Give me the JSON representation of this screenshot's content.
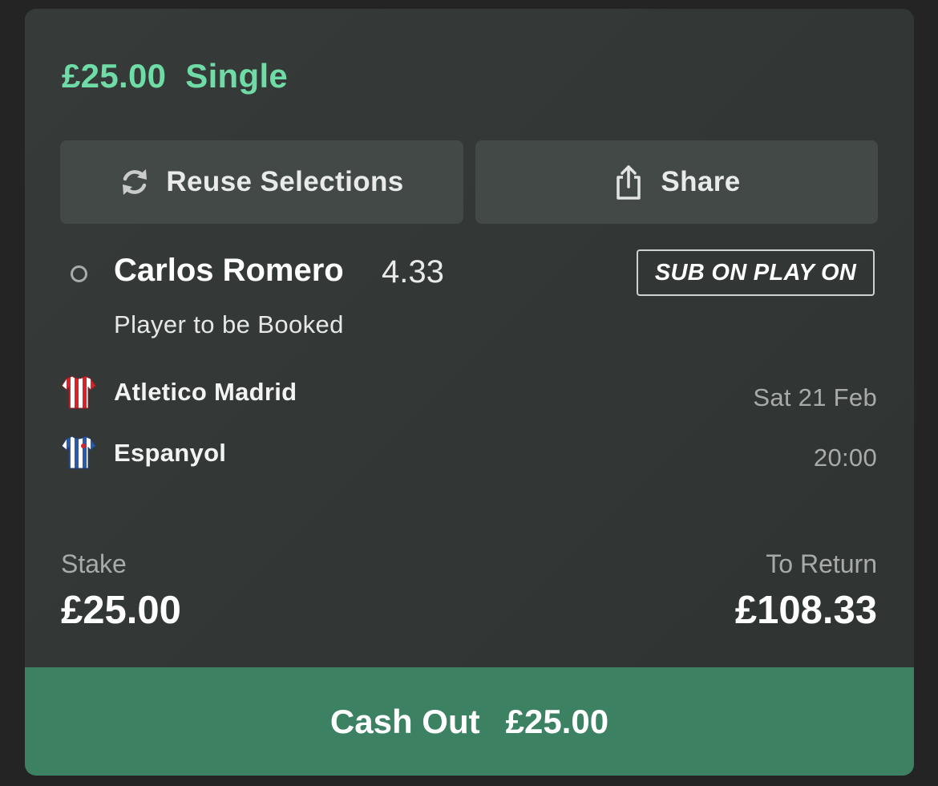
{
  "bet": {
    "stake_display": "£25.00",
    "type": "Single"
  },
  "actions": {
    "reuse_label": "Reuse Selections",
    "reuse_icon": "refresh-icon",
    "share_label": "Share",
    "share_icon": "share-icon"
  },
  "selection": {
    "player": "Carlos Romero",
    "odds": "4.33",
    "badge": "SUB ON PLAY ON",
    "market": "Player to be Booked"
  },
  "match": {
    "home_team": "Atletico Madrid",
    "away_team": "Espanyol",
    "date": "Sat 21 Feb",
    "time": "20:00",
    "home_kit_icon": "striped-shirt-icon",
    "away_kit_icon": "striped-shirt-icon"
  },
  "summary": {
    "stake_label": "Stake",
    "stake_value": "£25.00",
    "return_label": "To Return",
    "return_value": "£108.33"
  },
  "cashout": {
    "label": "Cash Out",
    "value": "£25.00"
  },
  "colors": {
    "accent_green": "#6fdca7",
    "cashout_bg": "#3d8163",
    "card_bg": "#333836"
  }
}
